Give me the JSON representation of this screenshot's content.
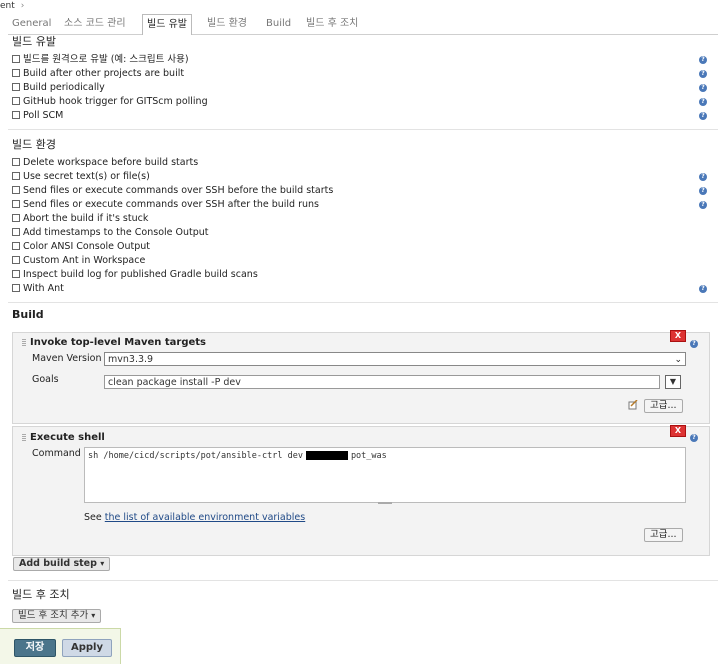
{
  "breadcrumb": {
    "text": "ent",
    "separator": "›"
  },
  "tabs": [
    "General",
    "소스 코드 관리",
    "빌드 유발",
    "빌드 환경",
    "Build",
    "빌드 후 조치"
  ],
  "triggers": {
    "title": "빌드 유발",
    "items": [
      "빌드를 원격으로 유발 (예: 스크립트 사용)",
      "Build after other projects are built",
      "Build periodically",
      "GitHub hook trigger for GITScm polling",
      "Poll SCM"
    ]
  },
  "environment": {
    "title": "빌드 환경",
    "items": [
      "Delete workspace before build starts",
      "Use secret text(s) or file(s)",
      "Send files or execute commands over SSH before the build starts",
      "Send files or execute commands over SSH after the build runs",
      "Abort the build if it's stuck",
      "Add timestamps to the Console Output",
      "Color ANSI Console Output",
      "Custom Ant in Workspace",
      "Inspect build log for published Gradle build scans",
      "With Ant"
    ]
  },
  "build": {
    "title": "Build",
    "maven": {
      "title": "Invoke top-level Maven targets",
      "version_label": "Maven Version",
      "version_value": "mvn3.3.9",
      "goals_label": "Goals",
      "goals_value": "clean package install -P dev",
      "advanced_label": "고급..."
    },
    "shell": {
      "title": "Execute shell",
      "command_label": "Command",
      "command_prefix": "sh /home/cicd/scripts/pot/ansible-ctrl dev",
      "command_suffix": "pot_was",
      "see_prefix": "See",
      "see_link": "the list of available environment variables",
      "advanced_label": "고급..."
    },
    "add_step_label": "Add build step"
  },
  "post_build": {
    "title": "빌드 후 조치",
    "add_label": "빌드 후 조치 추가"
  },
  "footer": {
    "save_label": "저장",
    "apply_label": "Apply"
  },
  "icons": {
    "delete": "X",
    "help": "?",
    "dropdown": "▼",
    "select_arrow": "⌄",
    "caret": "▾"
  },
  "colors": {
    "delete_red": "#dd3333",
    "help_blue": "#4a78b8",
    "save_bg": "#4b758b"
  }
}
